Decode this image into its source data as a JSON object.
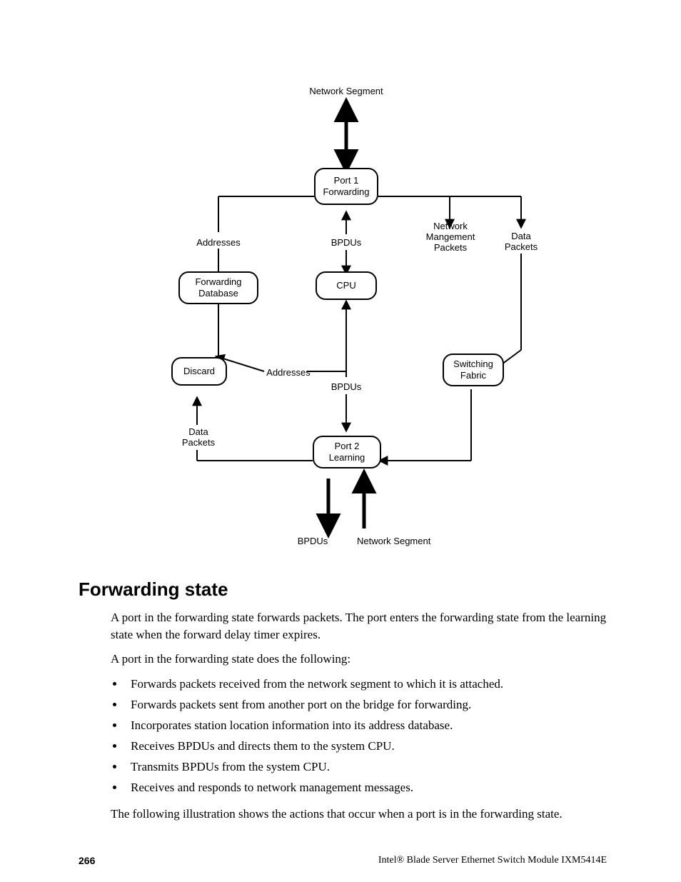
{
  "diagram": {
    "top_label": "Network Segment",
    "addresses_label_top": "Addresses",
    "bpdus_label_top": "BPDUs",
    "net_mgmt_label": "Network\nMangement\nPackets",
    "data_pkts_label_right": "Data\nPackets",
    "box_port1": "Port 1\nForwarding",
    "box_fwd_db": "Forwarding\nDatabase",
    "box_cpu": "CPU",
    "box_discard": "Discard",
    "addresses_label_mid": "Addresses",
    "box_switching": "Switching\nFabric",
    "bpdus_label_mid": "BPDUs",
    "data_pkts_label_left": "Data\nPackets",
    "box_port2": "Port 2\nLearning",
    "bpdus_label_bottom": "BPDUs",
    "bottom_label": "Network Segment"
  },
  "heading": "Forwarding state",
  "para1": "A port in the forwarding state forwards packets. The port enters the forwarding state from the learning state when the forward delay timer expires.",
  "para2": "A port in the forwarding state does the following:",
  "bullets": [
    "Forwards packets received from the network segment to which it is attached.",
    "Forwards packets sent from another port on the bridge for forwarding.",
    "Incorporates station location information into its address database.",
    "Receives BPDUs and directs them to the system CPU.",
    "Transmits BPDUs from the system CPU.",
    "Receives and responds to network management messages."
  ],
  "para3": "The following illustration shows the actions that occur when a port is in the forwarding state.",
  "footer": {
    "page": "266",
    "text": "Intel® Blade Server Ethernet Switch Module IXM5414E"
  }
}
